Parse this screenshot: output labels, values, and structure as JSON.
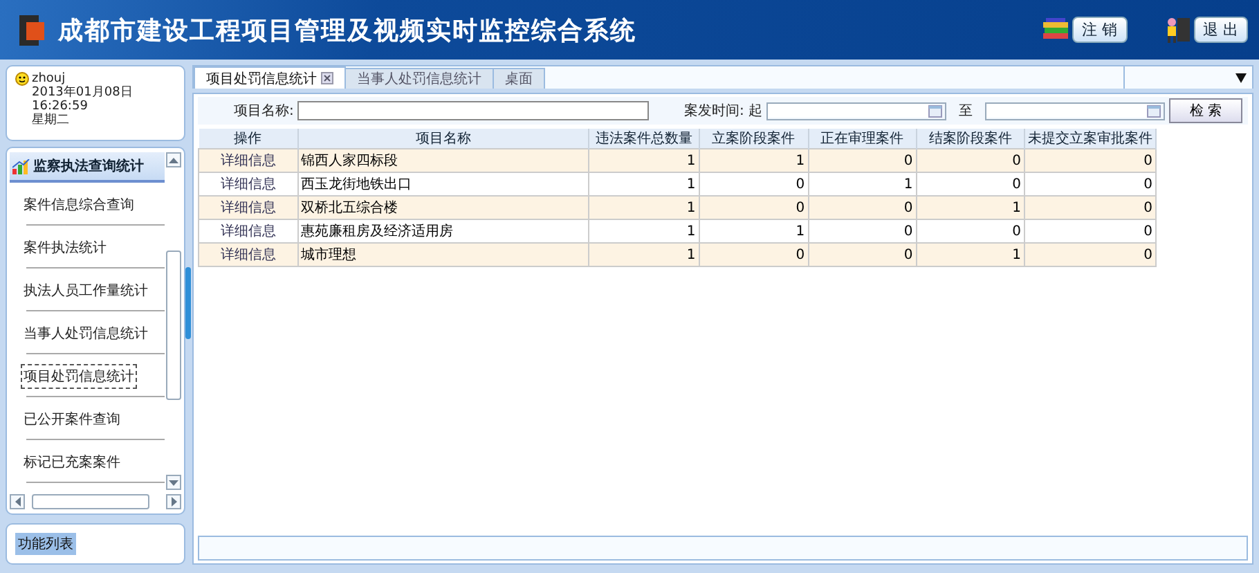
{
  "header": {
    "title": "成都市建设工程项目管理及视频实时监控综合系统",
    "buttons": [
      {
        "label": "注 销",
        "kind": "logout"
      },
      {
        "label": "退 出",
        "kind": "exit"
      }
    ]
  },
  "user": {
    "name": "zhouj",
    "date": "2013年01月08日",
    "time": "16:26:59",
    "weekday": "星期二"
  },
  "nav": {
    "section": "监察执法查询统计",
    "items": [
      {
        "label": "案件信息综合查询",
        "selected": false
      },
      {
        "label": "案件执法统计",
        "selected": false
      },
      {
        "label": "执法人员工作量统计",
        "selected": false
      },
      {
        "label": "当事人处罚信息统计",
        "selected": false
      },
      {
        "label": "项目处罚信息统计",
        "selected": true
      },
      {
        "label": "已公开案件查询",
        "selected": false
      },
      {
        "label": "标记已充案案件",
        "selected": false
      }
    ]
  },
  "bottom_panel": {
    "label": "功能列表"
  },
  "tabs": [
    {
      "label": "项目处罚信息统计",
      "selected": true,
      "closable": true
    },
    {
      "label": "当事人处罚信息统计",
      "selected": false,
      "closable": false
    },
    {
      "label": "桌面",
      "selected": false,
      "closable": false
    }
  ],
  "filter": {
    "name_label": "项目名称:",
    "time_label": "案发时间:",
    "from_label": "起",
    "to_label": "至",
    "search_button": "检 索"
  },
  "table": {
    "columns": [
      "操作",
      "项目名称",
      "违法案件总数量",
      "立案阶段案件",
      "正在审理案件",
      "结案阶段案件",
      "未提交立案审批案件"
    ],
    "rows": [
      {
        "cells": [
          "详细信息",
          "锦西人家四标段",
          "1",
          "1",
          "0",
          "0",
          "0"
        ]
      },
      {
        "cells": [
          "详细信息",
          "西玉龙街地铁出口",
          "1",
          "0",
          "1",
          "0",
          "0"
        ]
      },
      {
        "cells": [
          "详细信息",
          "双桥北五综合楼",
          "1",
          "0",
          "0",
          "1",
          "0"
        ]
      },
      {
        "cells": [
          "详细信息",
          "惠苑廉租房及经济适用房",
          "1",
          "1",
          "0",
          "0",
          "0"
        ]
      },
      {
        "cells": [
          "详细信息",
          "城市理想",
          "1",
          "0",
          "0",
          "1",
          "0"
        ]
      }
    ]
  }
}
